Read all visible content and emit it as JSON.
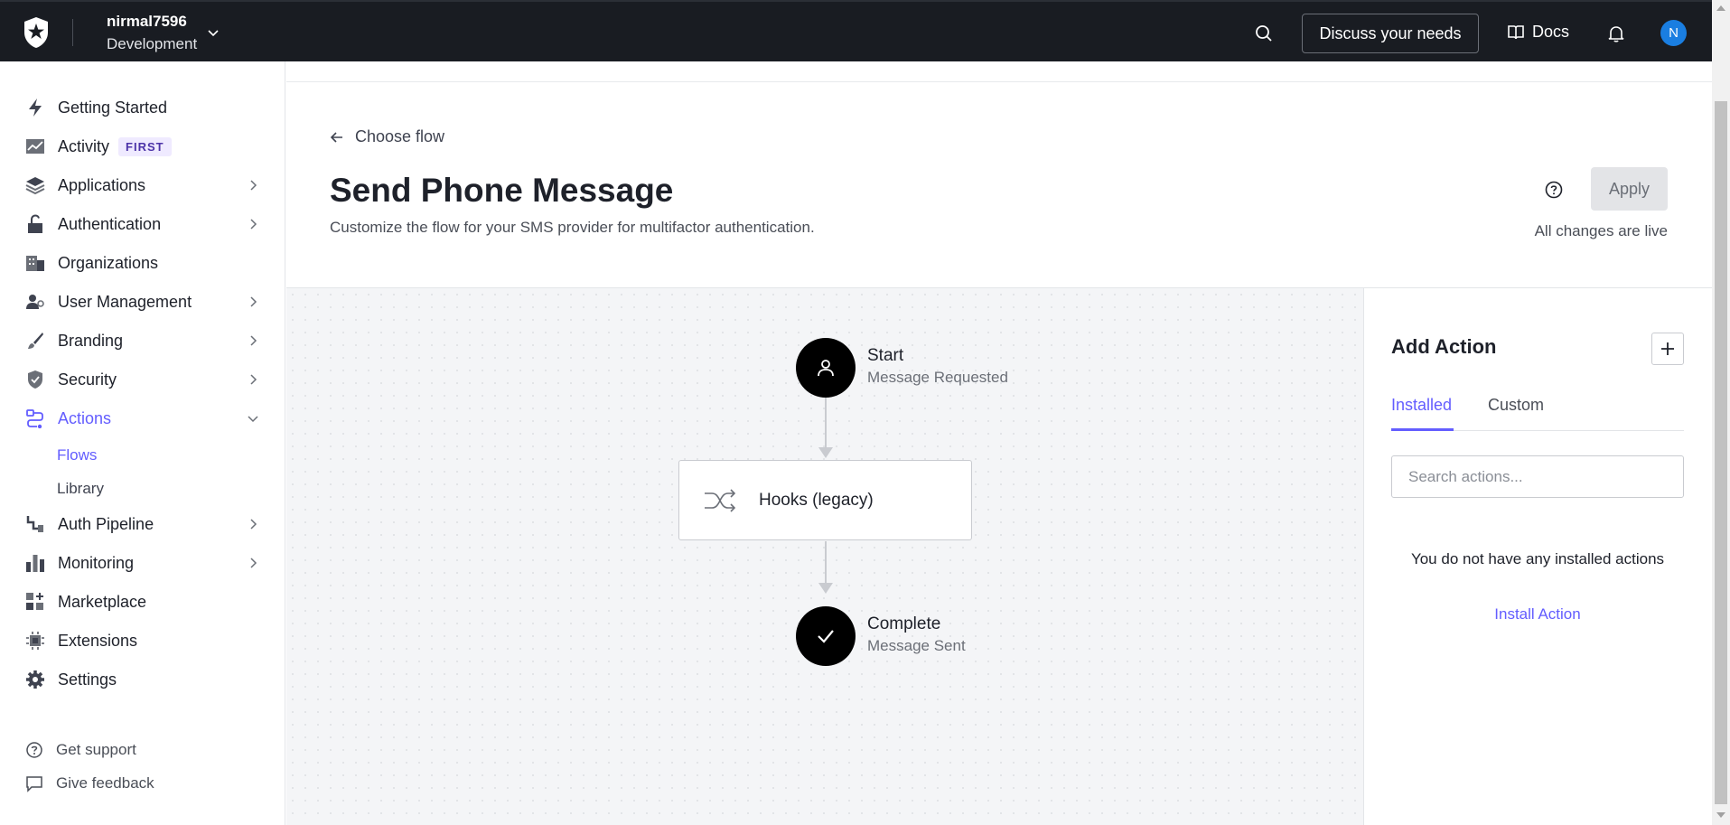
{
  "topbar": {
    "tenant_name": "nirmal7596",
    "tenant_env": "Development",
    "discuss_label": "Discuss your needs",
    "docs_label": "Docs",
    "avatar_initial": "N"
  },
  "sidebar": {
    "items": [
      {
        "label": "Getting Started",
        "icon": "bolt-icon"
      },
      {
        "label": "Activity",
        "icon": "activity-chart-icon",
        "badge": "FIRST"
      },
      {
        "label": "Applications",
        "icon": "layers-icon"
      },
      {
        "label": "Authentication",
        "icon": "lock-icon"
      },
      {
        "label": "Organizations",
        "icon": "building-icon"
      },
      {
        "label": "User Management",
        "icon": "users-icon"
      },
      {
        "label": "Branding",
        "icon": "brush-icon"
      },
      {
        "label": "Security",
        "icon": "shield-icon"
      },
      {
        "label": "Actions",
        "icon": "flow-icon"
      },
      {
        "label": "Auth Pipeline",
        "icon": "pipeline-icon"
      },
      {
        "label": "Monitoring",
        "icon": "bar-chart-icon"
      },
      {
        "label": "Marketplace",
        "icon": "grid-plus-icon"
      },
      {
        "label": "Extensions",
        "icon": "chip-icon"
      },
      {
        "label": "Settings",
        "icon": "gear-icon"
      }
    ],
    "sub_items": [
      "Flows",
      "Library"
    ],
    "footer": [
      "Get support",
      "Give feedback"
    ]
  },
  "header": {
    "back_label": "Choose flow",
    "title": "Send Phone Message",
    "description": "Customize the flow for your SMS provider for multifactor authentication.",
    "apply_label": "Apply",
    "live_text": "All changes are live"
  },
  "flow": {
    "start_title": "Start",
    "start_sub": "Message Requested",
    "hook_label": "Hooks (legacy)",
    "complete_title": "Complete",
    "complete_sub": "Message Sent"
  },
  "panel": {
    "title": "Add Action",
    "tabs": [
      "Installed",
      "Custom"
    ],
    "search_placeholder": "Search actions...",
    "empty_text": "You do not have any installed actions",
    "install_label": "Install Action"
  },
  "colors": {
    "topbar_bg": "#191c22",
    "accent": "#635dff",
    "avatar": "#1a7ee1"
  }
}
